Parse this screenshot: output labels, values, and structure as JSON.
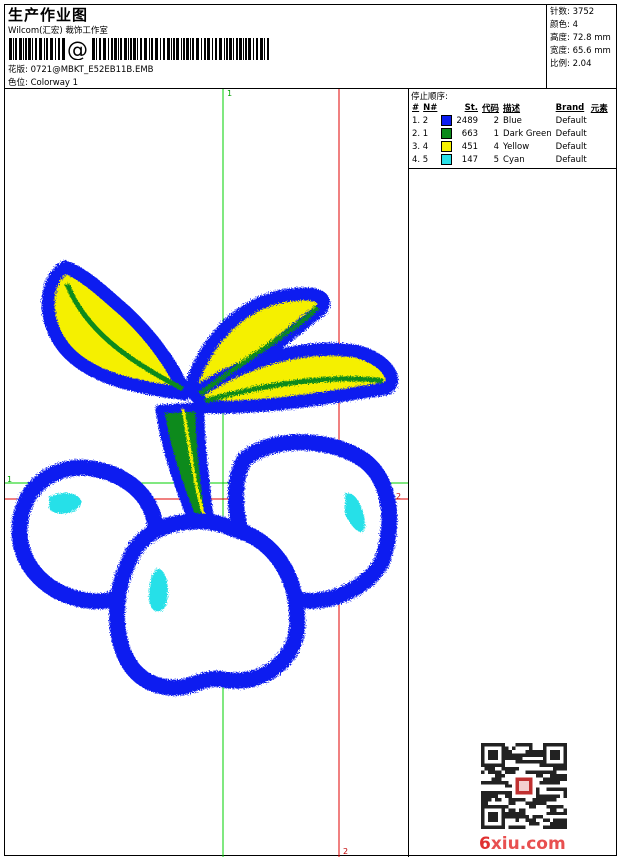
{
  "header": {
    "title": "生产作业图",
    "company": "Wilcom(汇宏) 裁饰工作室",
    "barcode_text": "@",
    "design_label": "花版:",
    "design_value": "0721@MBKT_E52EB11B.EMB",
    "colorway_label": "色位:",
    "colorway_value": "Colorway 1"
  },
  "stats": {
    "stitches": "针数: 3752",
    "colors": "颜色: 4",
    "height": "高度: 72.8 mm",
    "width": "宽度: 65.6 mm",
    "ratio": "比例: 2.04"
  },
  "stop_sequence": {
    "title": "停止顺序:",
    "headers": {
      "hash": "#",
      "no": "N#",
      "st": "St.",
      "code": "代码",
      "desc": "描述",
      "brand": "Brand",
      "element": "元素"
    },
    "rows": [
      {
        "idx": "1. 2",
        "color": "#0a1cf0",
        "st": "2489",
        "code": "2",
        "desc": "Blue",
        "brand": "Default"
      },
      {
        "idx": "2. 1",
        "color": "#0a8a1a",
        "st": "663",
        "code": "1",
        "desc": "Dark Green",
        "brand": "Default"
      },
      {
        "idx": "3. 4",
        "color": "#f5f000",
        "st": "451",
        "code": "4",
        "desc": "Yellow",
        "brand": "Default"
      },
      {
        "idx": "4. 5",
        "color": "#28e0e8",
        "st": "147",
        "code": "5",
        "desc": "Cyan",
        "brand": "Default"
      }
    ]
  },
  "axes": {
    "green_top": "1",
    "green_left": "1",
    "red_right": "2",
    "red_bottom": "2"
  },
  "colors": {
    "blue": "#0a1cf0",
    "green": "#0a8a1a",
    "yellow": "#f5f000",
    "cyan": "#28e0e8",
    "axis_green": "#00d000",
    "axis_red": "#e00000"
  },
  "watermark": {
    "prefix": "6",
    "rest": "xiu.com"
  }
}
